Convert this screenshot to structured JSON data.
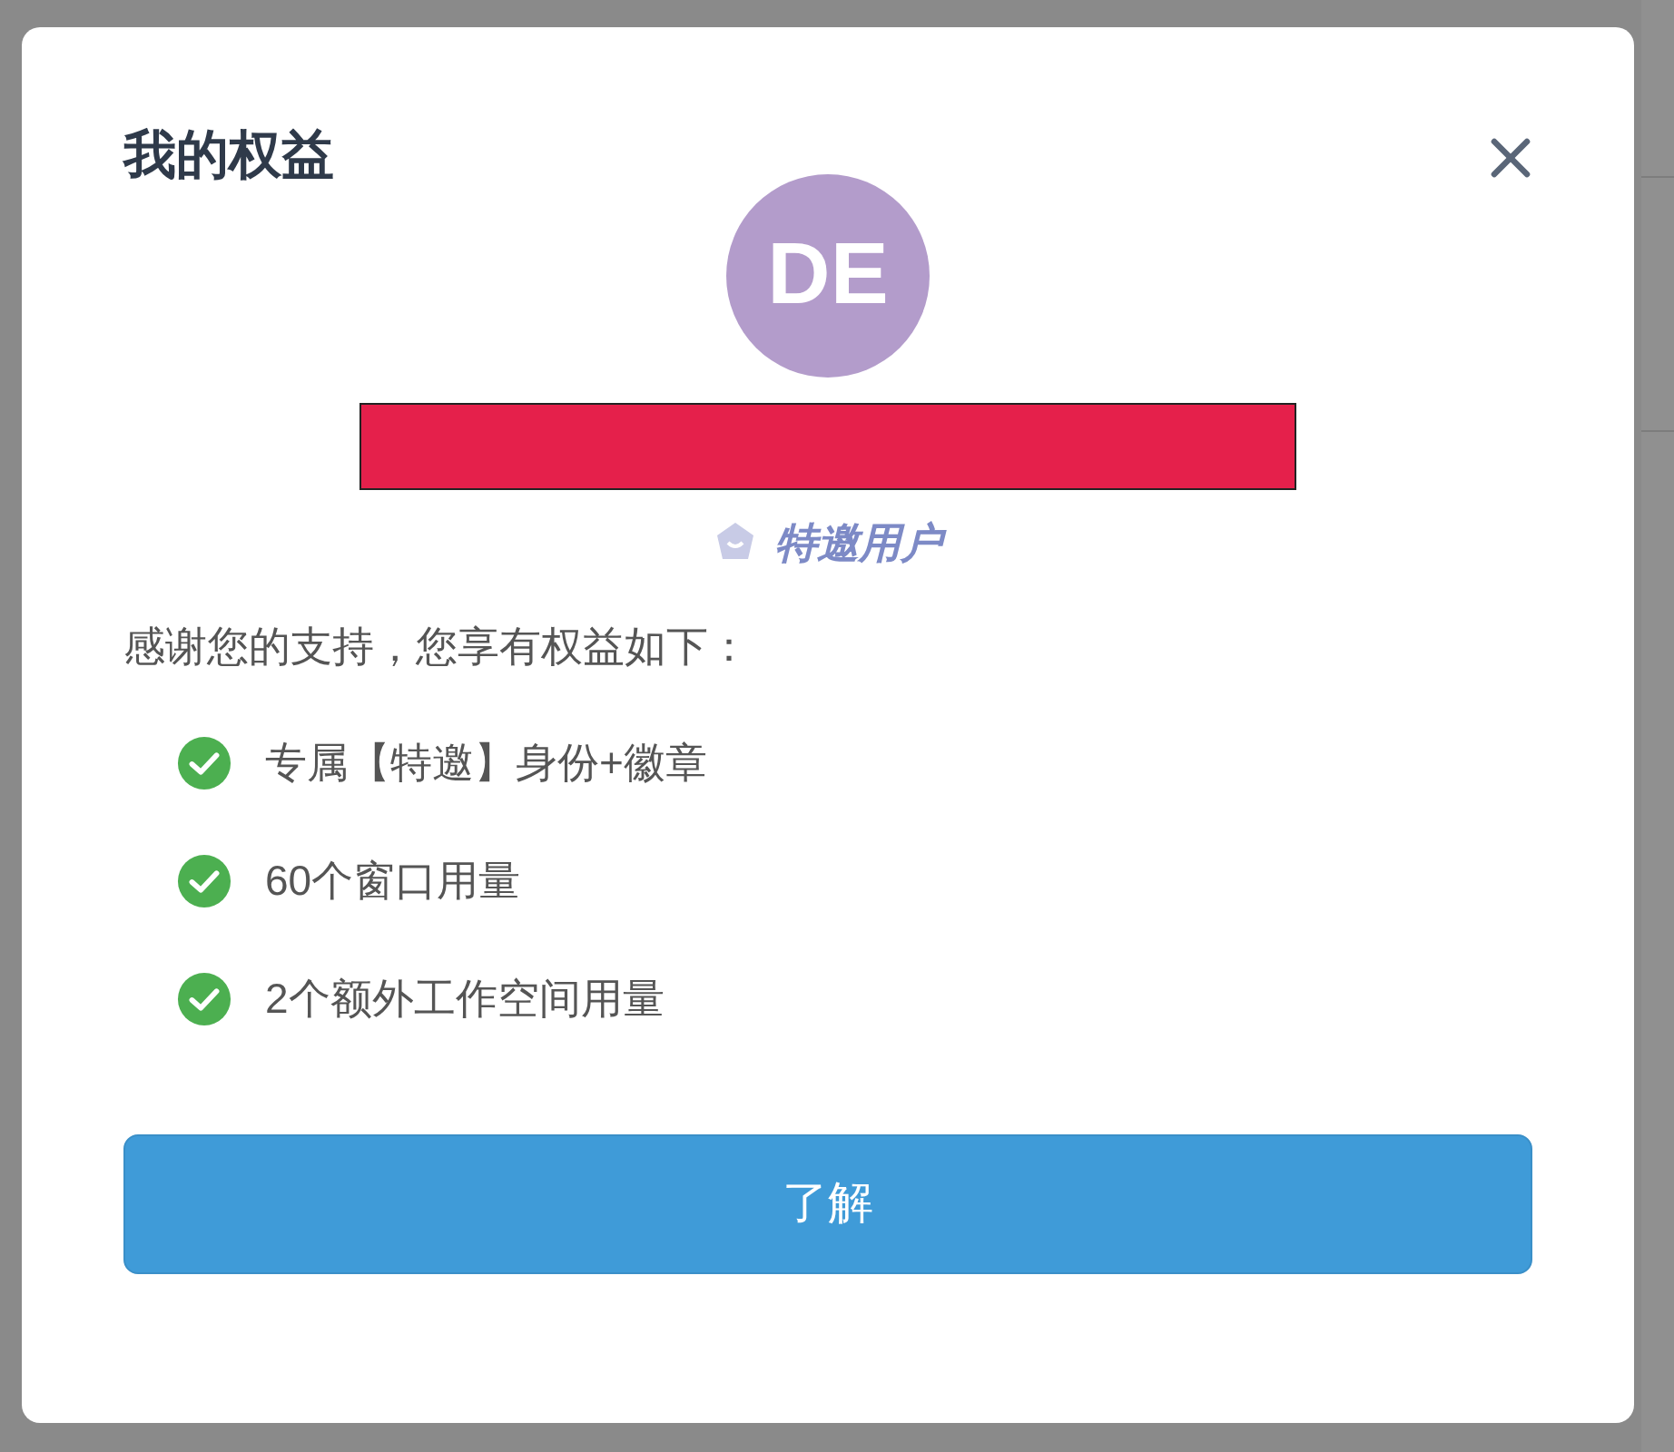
{
  "dialog": {
    "title": "我的权益",
    "avatar_initials": "DE",
    "badge": "特邀用户",
    "intro": "感谢您的支持，您享有权益如下：",
    "benefits": [
      {
        "text": "专属【特邀】身份+徽章",
        "checked": true
      },
      {
        "text": "60个窗口用量",
        "checked": true
      },
      {
        "text": "2个额外工作空间用量",
        "checked": true
      }
    ],
    "confirm_button": "了解"
  }
}
